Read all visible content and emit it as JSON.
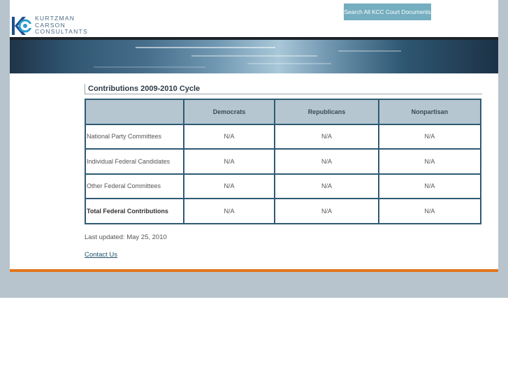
{
  "header": {
    "logo_lines": [
      "KURTZMAN",
      "CARSON",
      "CONSULTANTS"
    ],
    "search_button_label": "Search All KCC Court Documents"
  },
  "content": {
    "section_title": "Contributions 2009-2010 Cycle",
    "table": {
      "columns": [
        "",
        "Democrats",
        "Republicans",
        "Nonpartisan"
      ],
      "rows": [
        {
          "label": "National Party Committees",
          "values": [
            "N/A",
            "N/A",
            "N/A"
          ]
        },
        {
          "label": "Individual Federal Candidates",
          "values": [
            "N/A",
            "N/A",
            "N/A"
          ]
        },
        {
          "label": "Other Federal Committees",
          "values": [
            "N/A",
            "N/A",
            "N/A"
          ]
        },
        {
          "label": "Total Federal Contributions",
          "values": [
            "N/A",
            "N/A",
            "N/A"
          ]
        }
      ]
    },
    "last_updated": "Last updated: May 25, 2010",
    "contact_link": "Contact Us"
  },
  "colors": {
    "accent_orange": "#e2761c",
    "header_cell": "#b5c6d0",
    "table_border": "#2f5a73",
    "button": "#74aec0",
    "background": "#b7c4cd"
  }
}
